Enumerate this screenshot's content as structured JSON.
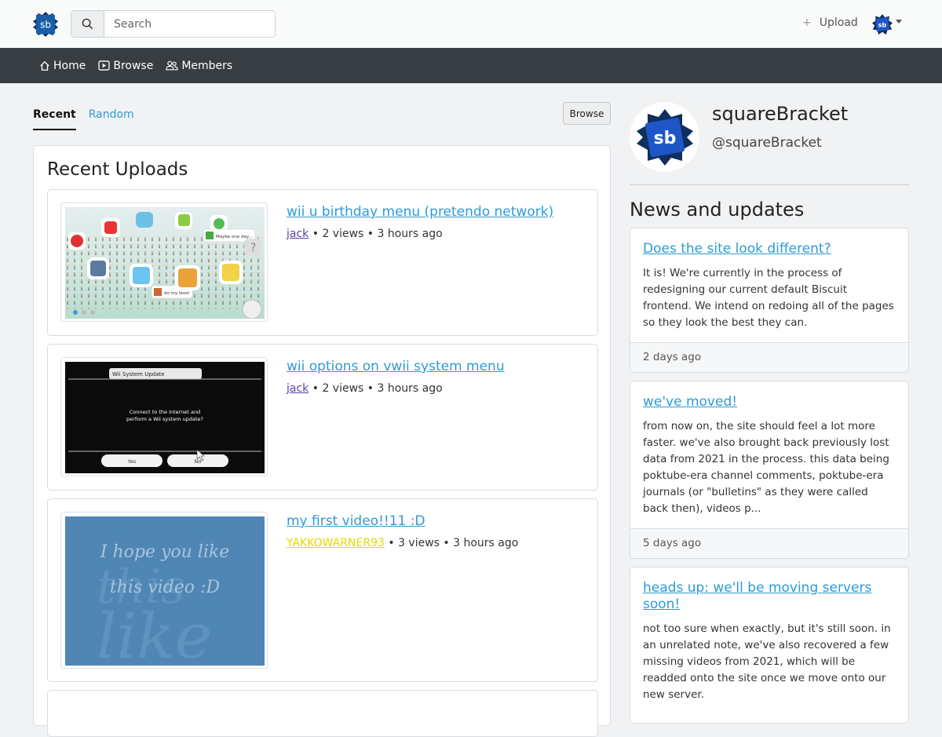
{
  "header": {
    "logo_text": "sb",
    "search_placeholder": "Search",
    "upload_label": "Upload",
    "avatar_text": "sb"
  },
  "nav": {
    "items": [
      {
        "label": "Home",
        "icon": "home-icon"
      },
      {
        "label": "Browse",
        "icon": "play-icon"
      },
      {
        "label": "Members",
        "icon": "members-icon"
      }
    ]
  },
  "tabs": {
    "recent": "Recent",
    "random": "Random",
    "browse_button": "Browse"
  },
  "uploads": {
    "title": "Recent Uploads",
    "videos": [
      {
        "title": "wii u birthday menu (pretendo network)",
        "author": "jack",
        "meta": " • 2 views • 3 hours ago"
      },
      {
        "title": "wii options on vwii system menu",
        "author": "jack",
        "meta": " • 2 views • 3 hours ago"
      },
      {
        "title": "my first video!!11 :D",
        "author": "YAKKOWARNER93",
        "meta": " • 3 views • 3 hours ago"
      }
    ]
  },
  "thumbnails": {
    "wiiu_bubbles": [
      "Maybe one day...",
      "do my level"
    ],
    "wii_update": {
      "window_title": "Wii System Update",
      "line1": "Connect to the Internet and",
      "line2": "perform a Wii system update?",
      "yes": "Yes",
      "no": "No"
    },
    "first_video": {
      "line1": "I hope you like",
      "line2": "this video :D",
      "bg_word1": "this",
      "bg_word2": "like"
    }
  },
  "profile": {
    "avatar_text": "sb",
    "name": "squareBracket",
    "handle": "@squareBracket"
  },
  "news": {
    "title": "News and updates",
    "items": [
      {
        "headline": "Does the site look different?",
        "body": "It is! We're currently in the process of redesigning our current default Biscuit frontend. We intend on redoing all of the pages so they look the best they can.",
        "time": "2 days ago"
      },
      {
        "headline": "we've moved!",
        "body": "from now on, the site should feel a lot more faster. we've also brought back previously lost data from 2021 in the process. this data being poktube-era channel comments, poktube-era journals (or \"bulletins\" as they were called back then), videos p...",
        "time": "5 days ago"
      },
      {
        "headline": "heads up: we'll be moving servers soon!",
        "body": "not too sure when exactly, but it's still soon. in an unrelated note, we've also recovered a few missing videos from 2021, which will be readded onto the site once we move onto our new server.",
        "time": ""
      }
    ]
  },
  "colors": {
    "nav_bg": "#383d42",
    "link": "#2c9bd6",
    "logo_blue": "#1a5ea8",
    "author_purple": "#5a3fa8",
    "author_yellow": "#e6d800"
  }
}
